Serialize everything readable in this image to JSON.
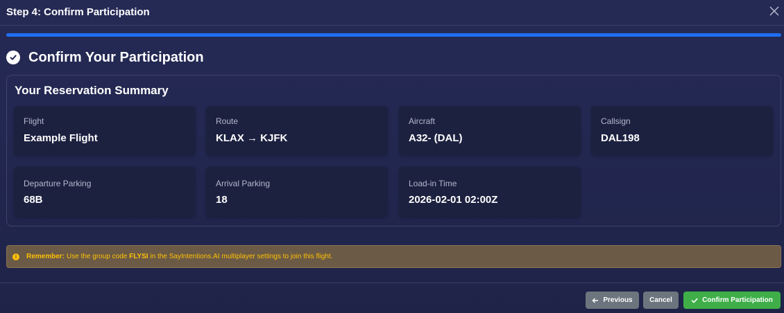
{
  "header": {
    "title": "Step 4: Confirm Participation",
    "close_icon": "close-icon"
  },
  "progress": {
    "percent": 100,
    "color": "#1f6ff2"
  },
  "section": {
    "title": "Confirm Your Participation",
    "icon": "check-circle-icon"
  },
  "summary": {
    "title": "Your Reservation Summary",
    "cards": [
      {
        "label": "Flight",
        "value": "Example Flight"
      },
      {
        "label": "Route",
        "value": "KLAX → KJFK"
      },
      {
        "label": "Aircraft",
        "value": "A32- (DAL)"
      },
      {
        "label": "Callsign",
        "value": "DAL198"
      },
      {
        "label": "Departure Parking",
        "value": "68B"
      },
      {
        "label": "Arrival Parking",
        "value": "18"
      },
      {
        "label": "Load-in Time",
        "value": "2026-02-01 02:00Z"
      }
    ]
  },
  "alert": {
    "icon": "info-icon",
    "icon_glyph": "i",
    "prefix": "Remember:",
    "text_before": "Use the group code",
    "code": "FLYSI",
    "text_after": "in the SayIntentions.AI multiplayer settings to join this flight."
  },
  "footer": {
    "previous_label": "Previous",
    "cancel_label": "Cancel",
    "confirm_label": "Confirm Participation"
  },
  "colors": {
    "background": "#232850",
    "card": "#1d2140",
    "accent": "#1f6ff2",
    "alert_bg": "#6b5a45",
    "alert_text": "#ffc107",
    "secondary_button": "#6c757d",
    "success_button": "#3fae49"
  }
}
